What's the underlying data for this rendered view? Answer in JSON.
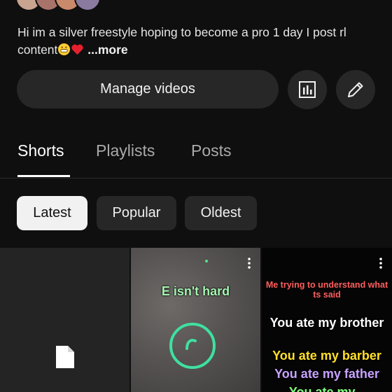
{
  "profile": {
    "name_partial": "▬▬ ▬▬▬▬▬▬",
    "bio": "Hi im a silver freestyle hoping to become a pro 1 day I post rl content",
    "bio_more": "...more"
  },
  "actions": {
    "manage_label": "Manage videos",
    "stats_icon": "analytics-icon",
    "edit_icon": "pencil-icon"
  },
  "tabs": [
    {
      "label": "Shorts",
      "active": true
    },
    {
      "label": "Playlists",
      "active": false
    },
    {
      "label": "Posts",
      "active": false
    }
  ],
  "filters": [
    {
      "label": "Latest",
      "selected": true
    },
    {
      "label": "Popular",
      "selected": false
    },
    {
      "label": "Oldest",
      "selected": false
    }
  ],
  "shorts": [
    {
      "thumb": "file-icon"
    },
    {
      "title": "E isn't hard"
    },
    {
      "caption_top": "Me trying to understand what ts said",
      "line1": "You ate my brother",
      "line2": "You ate my barber",
      "line3": "You ate my father",
      "line4": "You ate my..."
    }
  ],
  "colors": {
    "background": "#0f0f0f",
    "button_bg": "#272727",
    "chip_selected_bg": "#f1f1f1",
    "text": "#f1f1f1",
    "inactive_tab": "#aaaaaa"
  }
}
